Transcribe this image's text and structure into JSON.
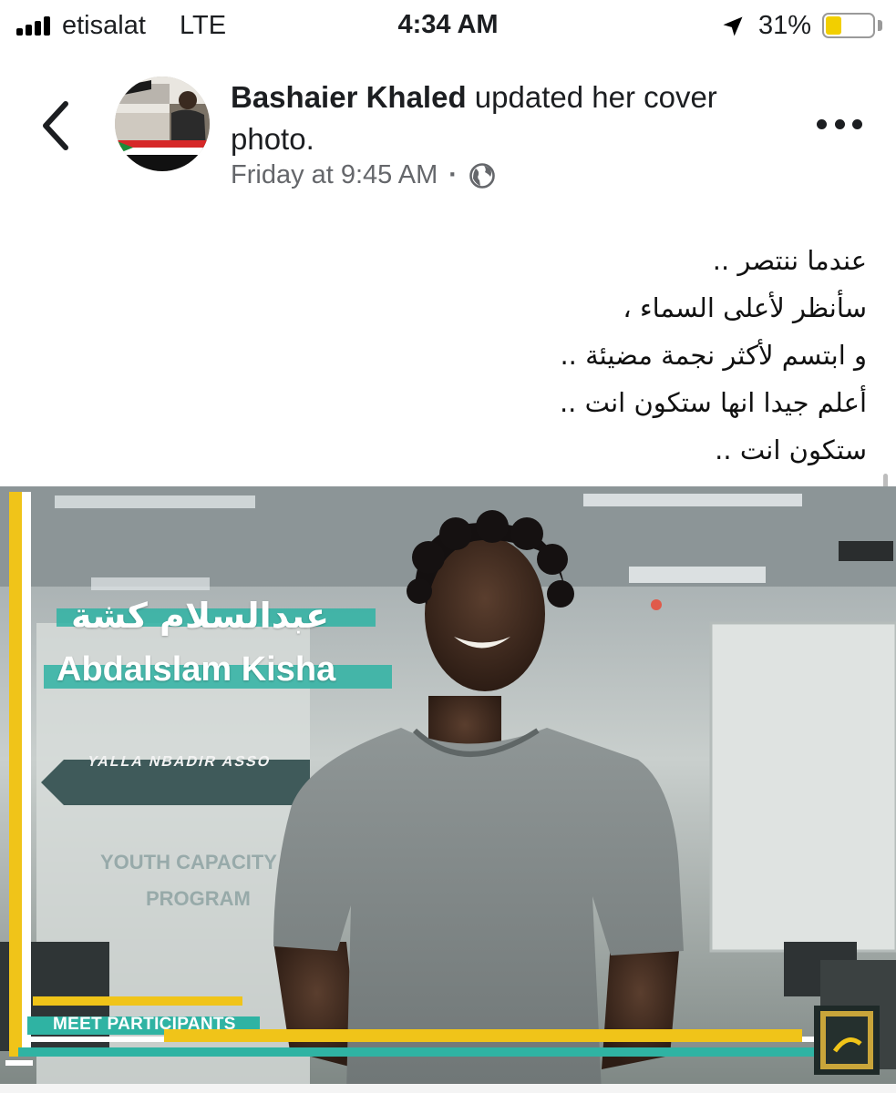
{
  "status_bar": {
    "carrier": "etisalat",
    "network": "LTE",
    "time": "4:34 AM",
    "battery_percent": "31%",
    "battery_level": 0.31,
    "battery_color": "#f2cf00"
  },
  "post": {
    "author": "Bashaier Khaled",
    "action": " updated her cover photo.",
    "timestamp": "Friday at 9:45 AM",
    "separator": "·",
    "privacy_icon": "globe-icon",
    "caption_lines": [
      "عندما ننتصر ..",
      "سأنظر لأعلى السماء ،",
      "و ابتسم لأكثر نجمة مضيئة ..",
      "أعلم جيدا انها ستكون انت ..",
      "ستكون انت .."
    ]
  },
  "cover_photo": {
    "name_ar": "عبدالسلام كشة",
    "name_en": "Abdalslam Kisha",
    "wall_banner": "YALLA NBADIR ASSO",
    "label": "MEET PARTICIPANTS",
    "accent_colors": {
      "yellow": "#f0c419",
      "teal": "#2fb3a3",
      "white": "#ffffff"
    }
  },
  "icons": {
    "back": "chevron-left-icon",
    "more": "more-horizontal-icon",
    "location": "location-arrow-icon"
  }
}
